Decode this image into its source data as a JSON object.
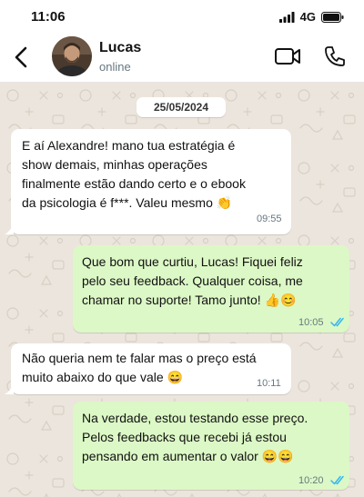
{
  "status_bar": {
    "time": "11:06",
    "network": "4G",
    "icons": [
      "signal-icon",
      "battery-icon"
    ]
  },
  "header": {
    "contact_name": "Lucas",
    "contact_status": "online",
    "icons": [
      "back-arrow-icon",
      "video-call-icon",
      "phone-icon"
    ]
  },
  "chat": {
    "date": "25/05/2024",
    "messages": [
      {
        "direction": "incoming",
        "lines": [
          "E aí Alexandre! mano tua estratégia é",
          "show demais, minhas operações",
          "finalmente estão dando certo e o ebook",
          "da psicologia é f***. Valeu mesmo 👏"
        ],
        "time": "09:55"
      },
      {
        "direction": "outgoing",
        "lines": [
          "Que bom que curtiu, Lucas! Fiquei feliz",
          "pelo seu feedback. Qualquer coisa, me",
          "chamar no suporte! Tamo junto! 👍😊"
        ],
        "time": "10:05",
        "read": true
      },
      {
        "direction": "incoming",
        "lines": [
          "Não queria nem te falar mas o preço está",
          "muito abaixo do que vale 😄"
        ],
        "time": "10:11"
      },
      {
        "direction": "outgoing",
        "lines": [
          "Na verdade, estou testando esse preço.",
          "Pelos feedbacks que recebi já estou",
          "pensando em aumentar o valor 😄😄"
        ],
        "time": "10:20",
        "read": true
      }
    ]
  },
  "colors": {
    "chat_background": "#ece5dd",
    "incoming_bubble": "#ffffff",
    "outgoing_bubble": "#dcf8c6",
    "read_ticks": "#34b7f1",
    "timestamp": "#667781"
  }
}
